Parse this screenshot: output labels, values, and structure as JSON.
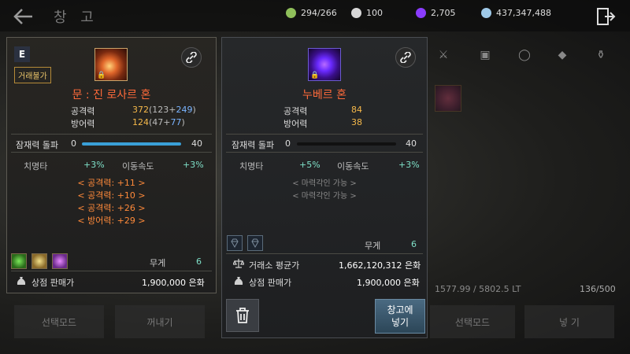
{
  "header": {
    "title": "창 고",
    "resources": [
      {
        "value": "294/266",
        "icon": "energy-icon",
        "color": "#8fbf5a"
      },
      {
        "value": "100",
        "icon": "pearl-icon",
        "color": "#d8d8d8"
      },
      {
        "value": "2,705",
        "icon": "gem-icon",
        "color": "#8a3cff"
      },
      {
        "value": "437,347,488",
        "icon": "silver-icon",
        "color": "#9fc9e8"
      }
    ]
  },
  "left_item": {
    "grade": "E",
    "trade_badge": "거래불가",
    "name": "문 : 진 로사르 혼",
    "attack_label": "공격력",
    "attack_value": "372",
    "attack_open": "(123+",
    "attack_bonus": "249",
    "attack_close": ")",
    "defense_label": "방어력",
    "defense_value": "124",
    "defense_open": "(47+",
    "defense_bonus": "77",
    "defense_close": ")",
    "potential_label": "잠재력 돌파",
    "potential_min": "0",
    "potential_max": "40",
    "potential_fill": 1.0,
    "opt1_label": "치명타",
    "opt1_value": "+3%",
    "opt2_label": "이동속도",
    "opt2_value": "+3%",
    "runes": [
      "< 공격력: +11 >",
      "< 공격력: +10 >",
      "< 공격력: +26 >",
      "< 방어력: +29 >"
    ],
    "weight_label": "무게",
    "weight_value": "6",
    "sell_label": "상점 판매가",
    "sell_value": "1,900,000 은화"
  },
  "right_item": {
    "name": "누베르 혼",
    "attack_label": "공격력",
    "attack_value": "84",
    "defense_label": "방어력",
    "defense_value": "38",
    "potential_label": "잠재력 돌파",
    "potential_min": "0",
    "potential_max": "40",
    "potential_fill": 0.0,
    "opt1_label": "치명타",
    "opt1_value": "+5%",
    "opt2_label": "이동속도",
    "opt2_value": "+3%",
    "engraves": [
      "< 마력각인 가능 >",
      "< 마력각인 가능 >"
    ],
    "weight_label": "무게",
    "weight_value": "6",
    "market_label": "거래소 평균가",
    "market_value": "1,662,120,312 은화",
    "sell_label": "상점 판매가",
    "sell_value": "1,900,000 은화",
    "store_button": "창고에\n넣기"
  },
  "background": {
    "weight_text": "1577.99 / 5802.5 LT",
    "count_text": "136/500",
    "left_buttons": [
      "선택모드",
      "꺼내기"
    ],
    "right_buttons": [
      "선택모드",
      "넣 기"
    ]
  }
}
